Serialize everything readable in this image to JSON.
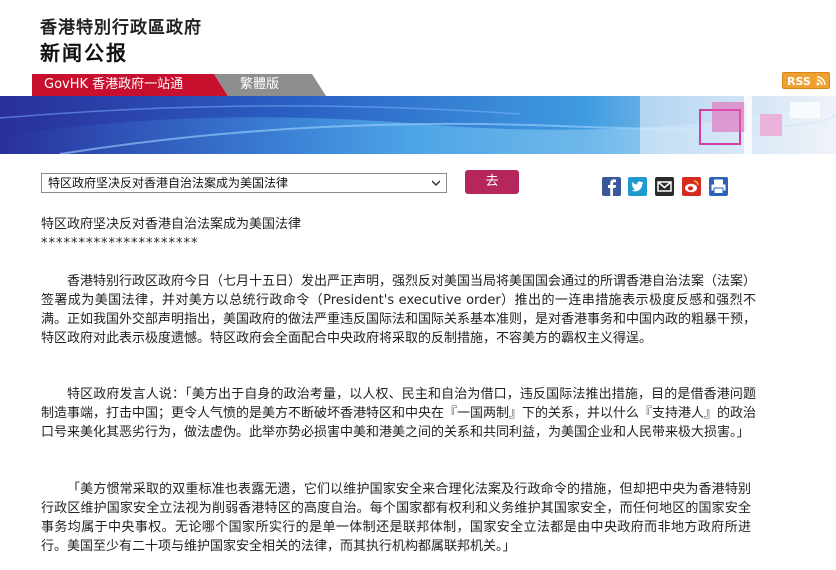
{
  "header": {
    "gov_name": "香港特別行政區政府",
    "section": "新闻公报"
  },
  "tabs": {
    "govhk": "GovHK 香港政府一站通",
    "traditional": "繁體版"
  },
  "rss": {
    "label": "RSS"
  },
  "selector": {
    "selected": "特区政府坚决反对香港自治法案成为美国法律",
    "go_label": "去"
  },
  "share": [
    "facebook-icon",
    "twitter-icon",
    "email-icon",
    "weibo-icon",
    "print-icon"
  ],
  "article": {
    "title": "特区政府坚决反对香港自治法案成为美国法律",
    "stars": "*********************",
    "paragraphs": [
      "香港特别行政区政府今日（七月十五日）发出严正声明，强烈反对美国当局将美国国会通过的所谓香港自治法案（法案）签署成为美国法律，并对美方以总统行政命令（President's executive order）推出的一连串措施表示极度反感和强烈不满。正如我国外交部声明指出，美国政府的做法严重违反国际法和国际关系基本准则，是对香港事务和中国内政的粗暴干预，特区政府对此表示极度遗憾。特区政府会全面配合中央政府将采取的反制措施，不容美方的霸权主义得逞。",
      "特区政府发言人说：「美方出于自身的政治考量，以人权、民主和自治为借口，违反国际法推出措施，目的是借香港问题制造事端，打击中国；更令人气愤的是美方不断破坏香港特区和中央在『一国两制』下的关系，并以什么『支持港人』的政治口号来美化其恶劣行为，做法虚伪。此举亦势必损害中美和港美之间的关系和共同利益，为美国企业和人民带来极大损害。」",
      "「美方惯常采取的双重标准也表露无遗，它们以维护国家安全来合理化法案及行政命令的措施，但却把中央为香港特别行政区维护国家安全立法视为削弱香港特区的高度自治。每个国家都有权利和义务维护其国家安全，而任何地区的国家安全事务均属于中央事权。无论哪个国家所实行的是单一体制还是联邦体制，国家安全立法都是由中央政府而非地方政府所进行。美国至少有二十项与维护国家安全相关的法律，而其执行机构都属联邦机关。」"
    ]
  },
  "colors": {
    "govhk_tab": "#c8102e",
    "trad_tab": "#8e8e8e",
    "go_button": "#b5275c",
    "rss": "#f0a030"
  }
}
